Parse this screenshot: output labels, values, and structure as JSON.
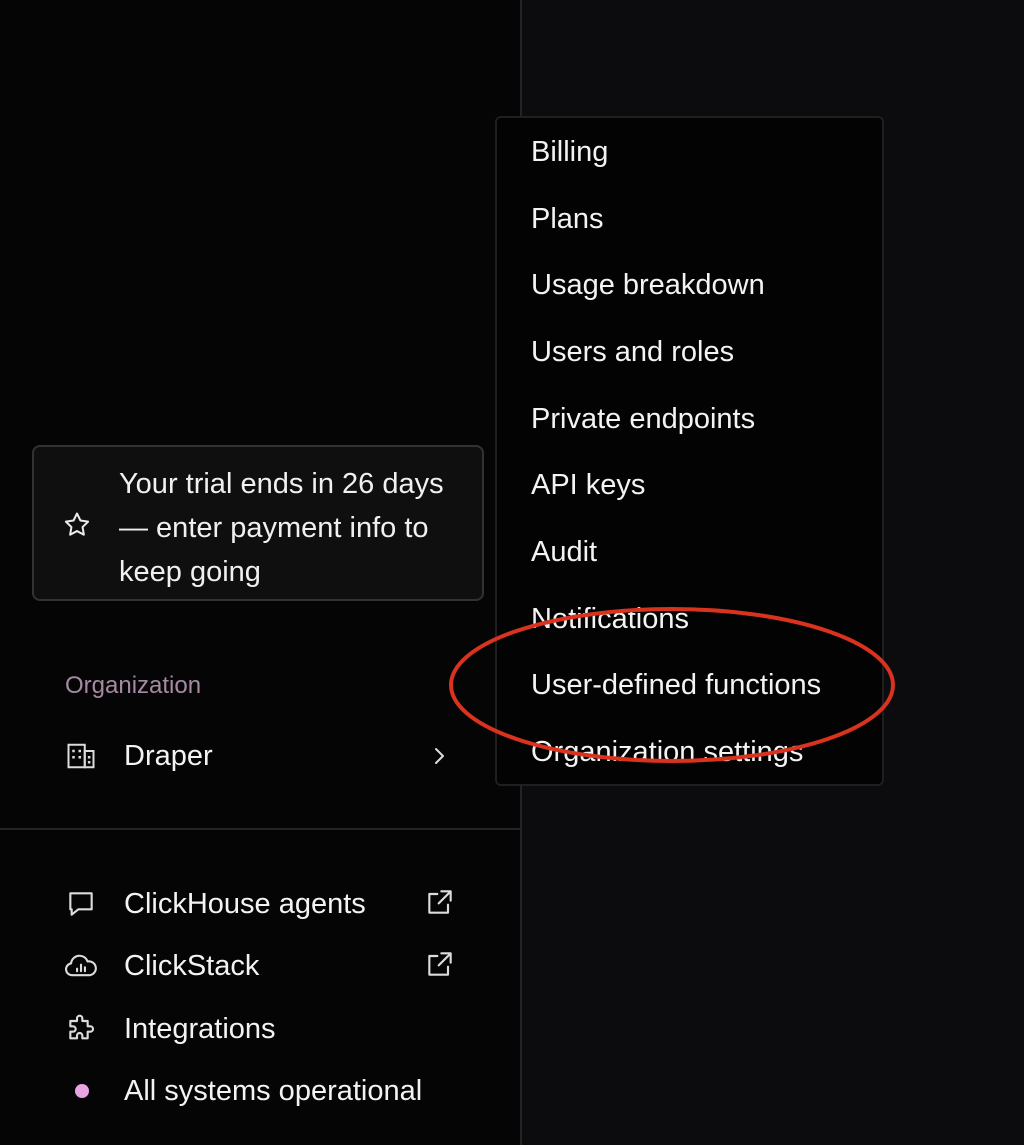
{
  "trial_banner": {
    "text": "Your trial ends in 26 days — enter payment info to keep going",
    "icon": "star-icon"
  },
  "organization": {
    "section_label": "Organization",
    "name": "Draper",
    "icon": "building-icon"
  },
  "bottom_nav": [
    {
      "label": "ClickHouse agents",
      "icon": "chat-bubble-icon",
      "external": true
    },
    {
      "label": "ClickStack",
      "icon": "cloud-chart-icon",
      "external": true
    },
    {
      "label": "Integrations",
      "icon": "puzzle-icon",
      "external": false
    },
    {
      "label": "All systems operational",
      "icon": "status-dot-icon",
      "external": false
    }
  ],
  "org_menu": {
    "items": [
      "Billing",
      "Plans",
      "Usage breakdown",
      "Users and roles",
      "Private endpoints",
      "API keys",
      "Audit",
      "Notifications",
      "User-defined functions",
      "Organization settings"
    ],
    "annotated_item": "User-defined functions"
  },
  "colors": {
    "status_dot": "#e6a5e2",
    "section_label": "#a68aa4",
    "annotation_ring": "#d9321f"
  }
}
